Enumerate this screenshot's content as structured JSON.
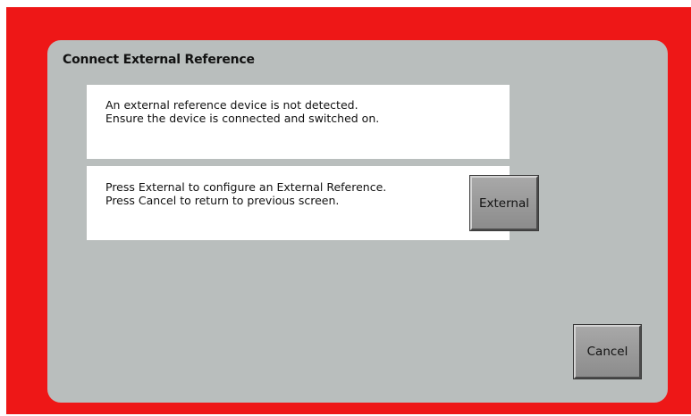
{
  "dialog": {
    "title": "Connect External Reference",
    "status_message": {
      "line1": "An external reference device is not detected.",
      "line2": "Ensure the device is connected and switched on."
    },
    "instruction_message": {
      "line1": "Press External to configure an External Reference.",
      "line2": "Press Cancel to return to previous screen."
    },
    "buttons": {
      "external_label": "External",
      "cancel_label": "Cancel"
    }
  },
  "colors": {
    "frame": "#ee1717",
    "panel": "#b9bebd",
    "message_box": "#ffffff",
    "button": "#9a9a9a"
  }
}
